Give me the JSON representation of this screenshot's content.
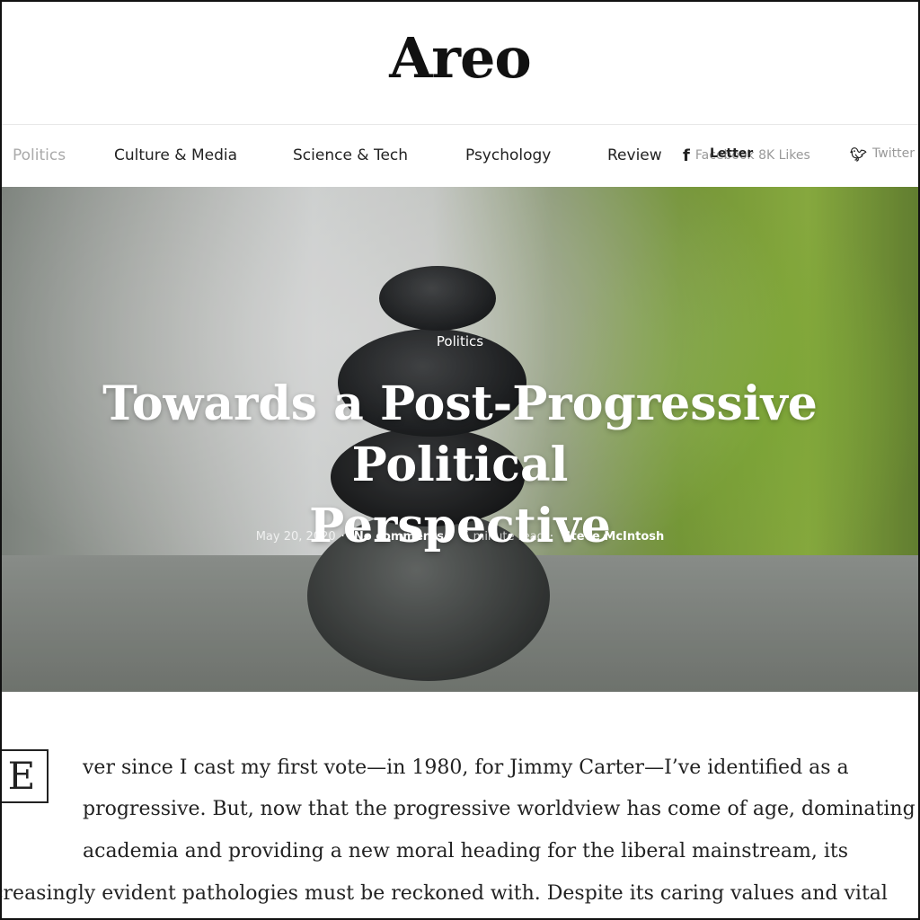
{
  "site": {
    "logo": "Areo"
  },
  "nav": {
    "items": [
      {
        "label": "Politics",
        "active": true
      },
      {
        "label": "Culture & Media"
      },
      {
        "label": "Science & Tech"
      },
      {
        "label": "Psychology"
      },
      {
        "label": "Review"
      }
    ],
    "newsletter": "Letter",
    "facebook": {
      "icon": "facebook-icon",
      "label": "Facebook 8K Likes"
    },
    "twitter": {
      "icon": "twitter-icon",
      "label": "Twitter"
    }
  },
  "hero": {
    "category": "Politics",
    "title_line1": "Towards a Post-Progressive Political",
    "title_line2": "Perspective",
    "date": "May 20, 2020",
    "comments": "No comments",
    "read_time": "5 minute read",
    "author": "Steve McIntosh"
  },
  "article": {
    "dropcap": "E",
    "lines": [
      "ver since I cast my first vote—in 1980, for Jimmy Carter—I’ve identified as a",
      "progressive. But, now that the progressive worldview has come of age, dominating",
      "academia and providing a new moral heading for the liberal mainstream, its",
      "increasingly evident pathologies must be reckoned with. Despite its caring values and vital"
    ]
  }
}
